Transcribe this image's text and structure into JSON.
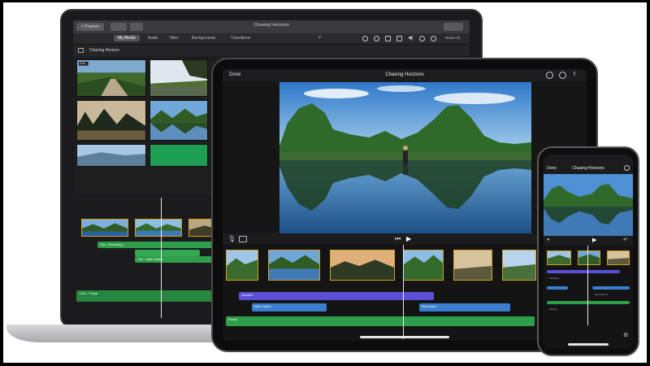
{
  "mac": {
    "toolbar": {
      "back_label": "< Projects",
      "title": "Chasing Horizons",
      "reset_label": "Reset All"
    },
    "tabs": [
      "My Media",
      "Audio",
      "Titles",
      "Backgrounds",
      "Transitions"
    ],
    "active_tab": "My Media",
    "library_title": "Chasing Horizon",
    "thumb_badge": "4.0s",
    "audio_clips": [
      {
        "label": "4.8s – Recording 1",
        "color": "#2f9e4a"
      },
      {
        "label": "1.5s – Water Splash",
        "color": "#2f9e4a"
      },
      {
        "label": "14.8s – Plunge",
        "color": "#27863f"
      }
    ]
  },
  "ipad": {
    "done_label": "Done",
    "title": "Chasing Horizons",
    "audio_labels": [
      "Narration",
      "Water Splash",
      "Recording 1",
      "Plunge"
    ],
    "colors": {
      "narration": "#5b4fd6",
      "splash": "#3b7fd0",
      "music": "#2f9e4a",
      "clip_border": "#d9a522"
    }
  },
  "iphone": {
    "done_label": "Done",
    "title": "Chasing Horizons",
    "track_labels": [
      "Narration",
      "Recording 1",
      "Plunge"
    ]
  },
  "icons": [
    "back-icon",
    "search-icon",
    "color-balance-icon",
    "crop-icon",
    "volume-icon",
    "speed-icon",
    "info-icon",
    "help-icon",
    "settings-icon",
    "play-icon",
    "microphone-icon",
    "undo-icon"
  ]
}
